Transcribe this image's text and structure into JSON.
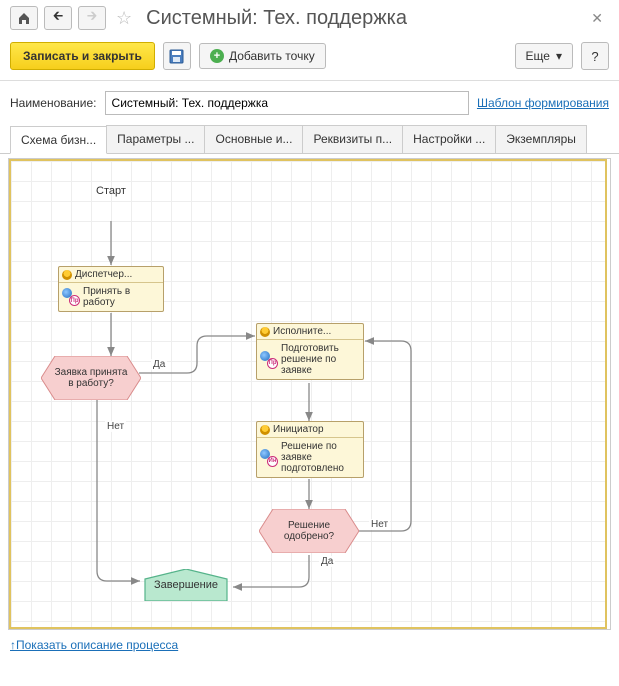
{
  "header": {
    "title": "Системный: Тех. поддержка"
  },
  "toolbar": {
    "save_close": "Записать и закрыть",
    "add_point": "Добавить точку",
    "more": "Еще",
    "help": "?"
  },
  "form": {
    "name_label": "Наименование:",
    "name_value": "Системный: Тех. поддержка",
    "template_link": "Шаблон формирования"
  },
  "tabs": [
    "Схема бизн...",
    "Параметры ...",
    "Основные и...",
    "Реквизиты п...",
    "Настройки ...",
    "Экземпляры"
  ],
  "flow": {
    "start": "Старт",
    "end": "Завершение",
    "node1": {
      "role": "Диспетчер...",
      "task": "Принять в работу",
      "badge": "Пр"
    },
    "node2": {
      "role": "Исполните...",
      "task": "Подготовить решение по заявке",
      "badge": "Пр"
    },
    "node3": {
      "role": "Инициатор",
      "task": "Решение по заявке подготовлено",
      "badge": "Ин"
    },
    "dec1": "Заявка принята в работу?",
    "dec2": "Решение одобрено?",
    "yes": "Да",
    "no": "Нет"
  },
  "footer": {
    "show_desc": "↑Показать описание процесса"
  }
}
